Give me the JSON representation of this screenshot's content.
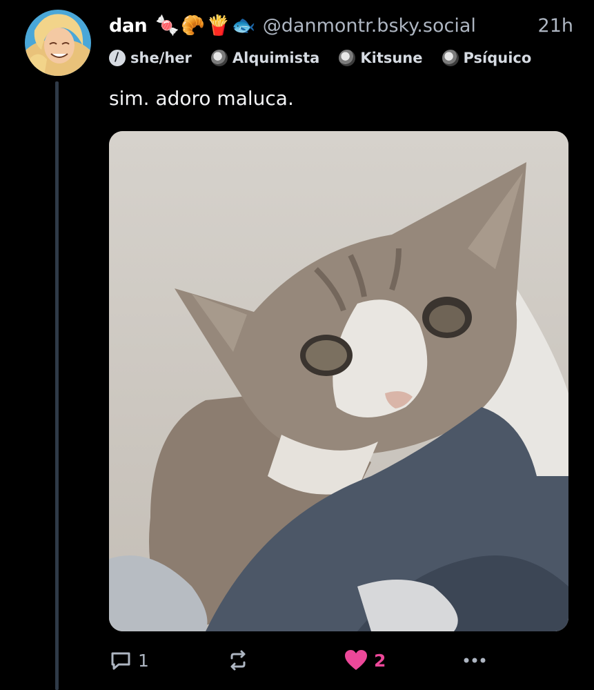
{
  "post": {
    "author": {
      "display_name": "dan",
      "emojis": [
        "🍬",
        "🥐",
        "🍟",
        "🐟"
      ],
      "handle": "@danmontr.bsky.social"
    },
    "time": "21h",
    "labels": [
      {
        "text": "she/her",
        "icon": "info-icon"
      },
      {
        "text": "Alquimista",
        "icon": "badge-icon"
      },
      {
        "text": "Kitsune",
        "icon": "badge-icon"
      },
      {
        "text": "Psíquico",
        "icon": "badge-icon"
      }
    ],
    "text": "sim. adoro maluca.",
    "actions": {
      "reply_count": "1",
      "like_count": "2"
    }
  },
  "colors": {
    "background": "#000000",
    "like": "#ec4899",
    "muted": "#aeb6c2",
    "thread_line": "#2f3a48"
  }
}
